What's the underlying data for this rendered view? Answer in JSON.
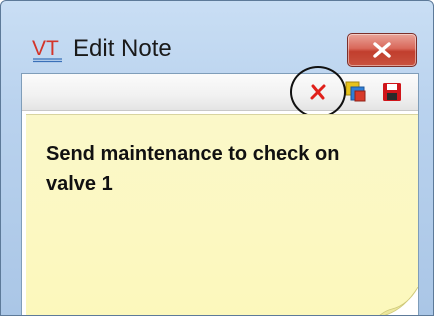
{
  "window": {
    "title": "Edit Note",
    "logo_text": "VT",
    "close_icon": "close-x-icon"
  },
  "toolbar": {
    "buttons": [
      {
        "icon": "delete-x-icon",
        "color": "#e0201a"
      },
      {
        "icon": "color-layers-icon"
      },
      {
        "icon": "save-floppy-icon",
        "color": "#d0151a"
      }
    ]
  },
  "note": {
    "text": "Send maintenance to check on\nvalve 1",
    "background": "#fcf8c0"
  },
  "colors": {
    "titlebar": "#b9d2ee",
    "close_button": "#c9523f"
  }
}
